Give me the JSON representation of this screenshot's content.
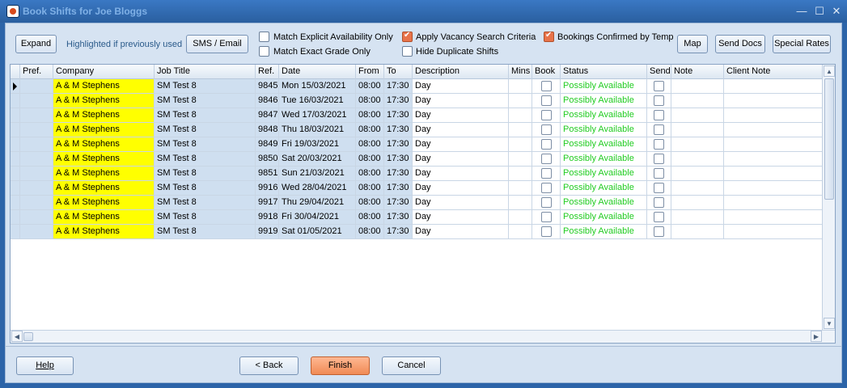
{
  "window": {
    "title": "Book Shifts for Joe Bloggs"
  },
  "toolbar": {
    "expand": "Expand",
    "highlight_hint": "Highlighted if previously used",
    "sms_email": "SMS / Email",
    "map": "Map",
    "send_docs": "Send Docs",
    "special_rates": "Special Rates"
  },
  "options": {
    "match_explicit": {
      "label": "Match Explicit Availability Only",
      "checked": false
    },
    "match_exact_grade": {
      "label": "Match Exact Grade Only",
      "checked": false
    },
    "apply_vacancy": {
      "label": "Apply Vacancy Search Criteria",
      "checked": true
    },
    "hide_duplicates": {
      "label": "Hide Duplicate Shifts",
      "checked": false
    },
    "bookings_confirmed": {
      "label": "Bookings Confirmed by Temp",
      "checked": true
    }
  },
  "grid": {
    "columns": [
      "Pref.",
      "Company",
      "Job Title",
      "Ref.",
      "Date",
      "From",
      "To",
      "Description",
      "Mins",
      "Book",
      "Status",
      "Send",
      "Note",
      "Client Note"
    ],
    "rows": [
      {
        "pref": "",
        "company": "A & M Stephens",
        "job": "SM Test 8",
        "ref": "9845",
        "date": "Mon 15/03/2021",
        "from": "08:00",
        "to": "17:30",
        "desc": "Day",
        "mins": "",
        "status": "Possibly Available",
        "note": "",
        "client_note": ""
      },
      {
        "pref": "",
        "company": "A & M Stephens",
        "job": "SM Test 8",
        "ref": "9846",
        "date": "Tue 16/03/2021",
        "from": "08:00",
        "to": "17:30",
        "desc": "Day",
        "mins": "",
        "status": "Possibly Available",
        "note": "",
        "client_note": ""
      },
      {
        "pref": "",
        "company": "A & M Stephens",
        "job": "SM Test 8",
        "ref": "9847",
        "date": "Wed 17/03/2021",
        "from": "08:00",
        "to": "17:30",
        "desc": "Day",
        "mins": "",
        "status": "Possibly Available",
        "note": "",
        "client_note": ""
      },
      {
        "pref": "",
        "company": "A & M Stephens",
        "job": "SM Test 8",
        "ref": "9848",
        "date": "Thu 18/03/2021",
        "from": "08:00",
        "to": "17:30",
        "desc": "Day",
        "mins": "",
        "status": "Possibly Available",
        "note": "",
        "client_note": ""
      },
      {
        "pref": "",
        "company": "A & M Stephens",
        "job": "SM Test 8",
        "ref": "9849",
        "date": "Fri 19/03/2021",
        "from": "08:00",
        "to": "17:30",
        "desc": "Day",
        "mins": "",
        "status": "Possibly Available",
        "note": "",
        "client_note": ""
      },
      {
        "pref": "",
        "company": "A & M Stephens",
        "job": "SM Test 8",
        "ref": "9850",
        "date": "Sat 20/03/2021",
        "from": "08:00",
        "to": "17:30",
        "desc": "Day",
        "mins": "",
        "status": "Possibly Available",
        "note": "",
        "client_note": ""
      },
      {
        "pref": "",
        "company": "A & M Stephens",
        "job": "SM Test 8",
        "ref": "9851",
        "date": "Sun 21/03/2021",
        "from": "08:00",
        "to": "17:30",
        "desc": "Day",
        "mins": "",
        "status": "Possibly Available",
        "note": "",
        "client_note": ""
      },
      {
        "pref": "",
        "company": "A & M Stephens",
        "job": "SM Test 8",
        "ref": "9916",
        "date": "Wed 28/04/2021",
        "from": "08:00",
        "to": "17:30",
        "desc": "Day",
        "mins": "",
        "status": "Possibly Available",
        "note": "",
        "client_note": ""
      },
      {
        "pref": "",
        "company": "A & M Stephens",
        "job": "SM Test 8",
        "ref": "9917",
        "date": "Thu 29/04/2021",
        "from": "08:00",
        "to": "17:30",
        "desc": "Day",
        "mins": "",
        "status": "Possibly Available",
        "note": "",
        "client_note": ""
      },
      {
        "pref": "",
        "company": "A & M Stephens",
        "job": "SM Test 8",
        "ref": "9918",
        "date": "Fri 30/04/2021",
        "from": "08:00",
        "to": "17:30",
        "desc": "Day",
        "mins": "",
        "status": "Possibly Available",
        "note": "",
        "client_note": ""
      },
      {
        "pref": "",
        "company": "A & M Stephens",
        "job": "SM Test 8",
        "ref": "9919",
        "date": "Sat 01/05/2021",
        "from": "08:00",
        "to": "17:30",
        "desc": "Day",
        "mins": "",
        "status": "Possibly Available",
        "note": "",
        "client_note": ""
      }
    ]
  },
  "footer": {
    "help": "Help",
    "back": "< Back",
    "finish": "Finish",
    "cancel": "Cancel"
  },
  "colors": {
    "highlight": "#ffff00",
    "status_available": "#22cc22",
    "accent": "#f08a55"
  },
  "icons": {
    "app": "app-logo-icon",
    "minimize": "minimize-icon",
    "maximize": "maximize-icon",
    "close": "close-icon"
  }
}
